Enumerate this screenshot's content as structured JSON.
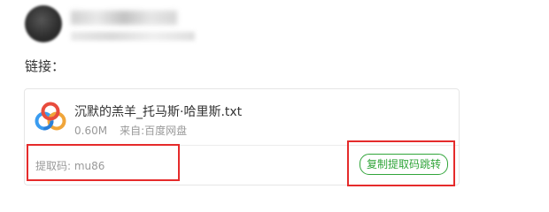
{
  "link": {
    "label": "链接："
  },
  "file": {
    "name": "沉默的羔羊_托马斯·哈里斯.txt",
    "size": "0.60M",
    "source": "来自:百度网盘"
  },
  "extraction": {
    "code_text": "提取码: mu86"
  },
  "actions": {
    "copy_button_label": "复制提取码跳转"
  },
  "colors": {
    "accent": "#31a53a",
    "highlight": "#e52b2b"
  }
}
